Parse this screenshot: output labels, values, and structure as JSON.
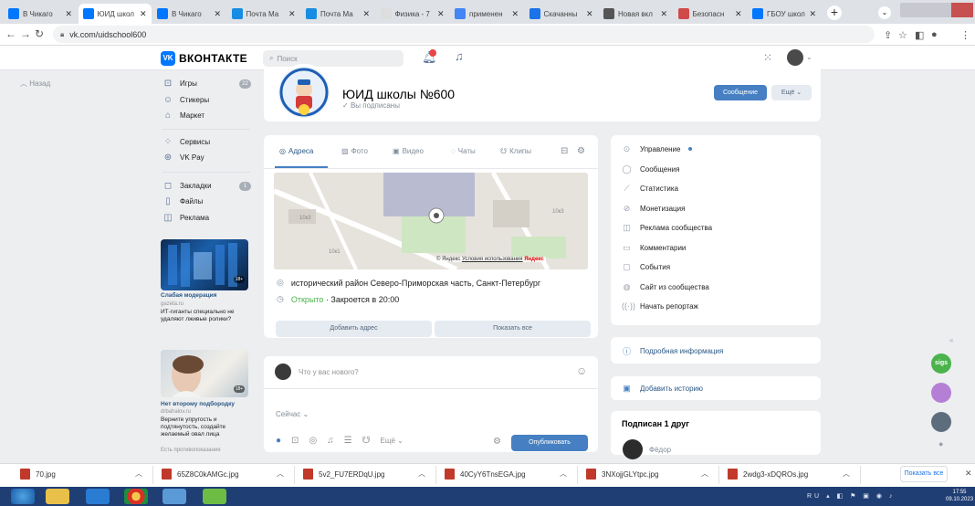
{
  "browser": {
    "tabs": [
      {
        "title": "В Чикаго",
        "icon": "vk-icon",
        "color": "#0077ff",
        "active": false
      },
      {
        "title": "ЮИД школ",
        "icon": "vk-icon",
        "color": "#0077ff",
        "active": true
      },
      {
        "title": "В Чикаго",
        "icon": "vk-icon",
        "color": "#0077ff",
        "active": false
      },
      {
        "title": "Почта Ма",
        "icon": "mail-icon",
        "color": "#168de2",
        "active": false
      },
      {
        "title": "Почта Ма",
        "icon": "mail-icon",
        "color": "#168de2",
        "active": false
      },
      {
        "title": "Физика - 7",
        "icon": "doc-icon",
        "color": "#dddddd",
        "active": false
      },
      {
        "title": "применен",
        "icon": "google-icon",
        "color": "#4285f4",
        "active": false
      },
      {
        "title": "Скачанны",
        "icon": "download-icon",
        "color": "#1a73e8",
        "active": false
      },
      {
        "title": "Новая вкл",
        "icon": "chrome-icon",
        "color": "#555555",
        "active": false
      },
      {
        "title": "Безопасн",
        "icon": "shield-icon",
        "color": "#d04a4a",
        "active": false
      },
      {
        "title": "ГБОУ школ",
        "icon": "vk-icon",
        "color": "#0077ff",
        "active": false
      }
    ],
    "new_tab": "+",
    "url": "vk.com/uidschool600"
  },
  "vk": {
    "logo_text": "ВКОНТАКТЕ",
    "logo_mark": "VK",
    "search_placeholder": "Поиск",
    "back_link": "Назад"
  },
  "left_nav": {
    "items": [
      {
        "icon": "gamepad-icon",
        "glyph": "⊡",
        "label": "Игры",
        "badge": "22"
      },
      {
        "icon": "sticker-icon",
        "glyph": "☺",
        "label": "Стикеры"
      },
      {
        "icon": "market-icon",
        "glyph": "⌂",
        "label": "Маркет"
      },
      {
        "icon": "services-icon",
        "glyph": "⁘",
        "label": "Сервисы"
      },
      {
        "icon": "vkpay-icon",
        "glyph": "⊛",
        "label": "VK Pay"
      },
      {
        "icon": "bookmark-icon",
        "glyph": "◻",
        "label": "Закладки",
        "badge": "1"
      },
      {
        "icon": "file-icon",
        "glyph": "▯",
        "label": "Файлы"
      },
      {
        "icon": "ads-icon",
        "glyph": "◫",
        "label": "Реклама"
      }
    ],
    "ads": [
      {
        "title": "Слабая модерация",
        "site": "gazeta.ru",
        "text": "ИТ-гиганты специально не удаляют лживые ролики?",
        "age": "18+"
      },
      {
        "title": "Нет второму подбородку",
        "site": "drbahalov.ru",
        "text": "Верните упругость и подтянутость, создайте желаемый овал лица",
        "subtext": "Есть противопоказания",
        "age": "18+"
      }
    ]
  },
  "group": {
    "name": "ЮИД школы №600",
    "status": "Вы подписаны",
    "message_button": "Сообщение",
    "more_button": "Ещё"
  },
  "info": {
    "tabs": [
      {
        "icon": "pin-icon",
        "glyph": "◎",
        "label": "Адреса",
        "active": true
      },
      {
        "icon": "photo-icon",
        "glyph": "▨",
        "label": "Фото"
      },
      {
        "icon": "video-icon",
        "glyph": "▣",
        "label": "Видео"
      },
      {
        "icon": "chat-icon",
        "glyph": "◌",
        "label": "Чаты"
      },
      {
        "icon": "clips-icon",
        "glyph": "☋",
        "label": "Клипы"
      }
    ],
    "map_credit_prefix": "© Яндекс",
    "map_credit_link": "Условия использования",
    "map_brand": "Яндекс",
    "map_labels": [
      "10к3",
      "10к1",
      "10к3"
    ],
    "address": "исторический район Северо-Приморская часть, Санкт-Петербург",
    "open_status": "Открыто",
    "closes_text": " · Закроется в 20:00",
    "add_address_button": "Добавить адрес",
    "show_all_button": "Показать все"
  },
  "post": {
    "placeholder": "Что у вас нового?",
    "now_label": "Сейчас",
    "more_label": "Ещё",
    "publish_button": "Опубликовать"
  },
  "manage_menu": {
    "items": [
      {
        "icon": "manage-icon",
        "glyph": "⊙",
        "label": "Управление"
      },
      {
        "icon": "messages-icon",
        "glyph": "◯",
        "label": "Сообщения"
      },
      {
        "icon": "stats-icon",
        "glyph": "⟋",
        "label": "Статистика"
      },
      {
        "icon": "monetize-icon",
        "glyph": "⊘",
        "label": "Монетизация"
      },
      {
        "icon": "promo-icon",
        "glyph": "◫",
        "label": "Реклама сообщества"
      },
      {
        "icon": "comments-icon",
        "glyph": "▭",
        "label": "Комментарии"
      },
      {
        "icon": "events-icon",
        "glyph": "▢",
        "label": "События"
      },
      {
        "icon": "site-icon",
        "glyph": "◍",
        "label": "Сайт из сообщества"
      },
      {
        "icon": "broadcast-icon",
        "glyph": "((·))",
        "label": "Начать репортаж"
      }
    ],
    "details": "Подробная информация",
    "add_story": "Добавить историю",
    "friends_title": "Подписан 1 друг",
    "friend_name": "Фёдор"
  },
  "downloads": {
    "files": [
      "70.jpg",
      "65Z8C0kAMGc.jpg",
      "5v2_FU7ERDqU.jpg",
      "40CyY6TnsEGA.jpg",
      "3NXojjGLYtpc.jpg",
      "2wdg3-xDQROs.jpg"
    ],
    "show_all": "Показать все"
  },
  "taskbar": {
    "tray_text": "RU",
    "time": "17:55",
    "date": "09.10.2023"
  }
}
